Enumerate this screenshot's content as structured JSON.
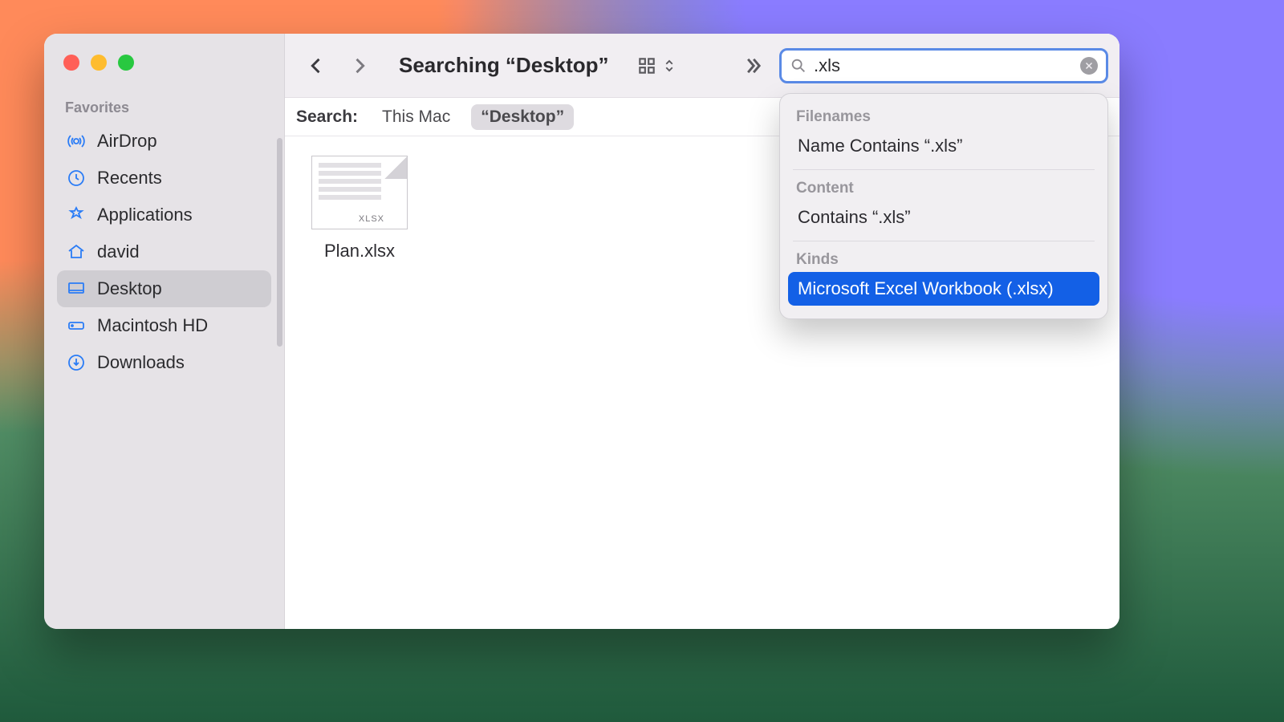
{
  "sidebar": {
    "section": "Favorites",
    "items": [
      {
        "label": "AirDrop"
      },
      {
        "label": "Recents"
      },
      {
        "label": "Applications"
      },
      {
        "label": "david"
      },
      {
        "label": "Desktop"
      },
      {
        "label": "Macintosh HD"
      },
      {
        "label": "Downloads"
      }
    ]
  },
  "toolbar": {
    "title": "Searching “Desktop”",
    "search_value": ".xls"
  },
  "scope": {
    "label": "Search:",
    "options": [
      {
        "label": "This Mac"
      },
      {
        "label": "“Desktop”"
      }
    ]
  },
  "results": [
    {
      "name": "Plan.xlsx",
      "badge": "XLSX"
    }
  ],
  "suggestions": {
    "filenames_label": "Filenames",
    "filenames_item": "Name Contains “.xls”",
    "content_label": "Content",
    "content_item": "Contains “.xls”",
    "kinds_label": "Kinds",
    "kinds_item": "Microsoft Excel Workbook (.xlsx)"
  }
}
